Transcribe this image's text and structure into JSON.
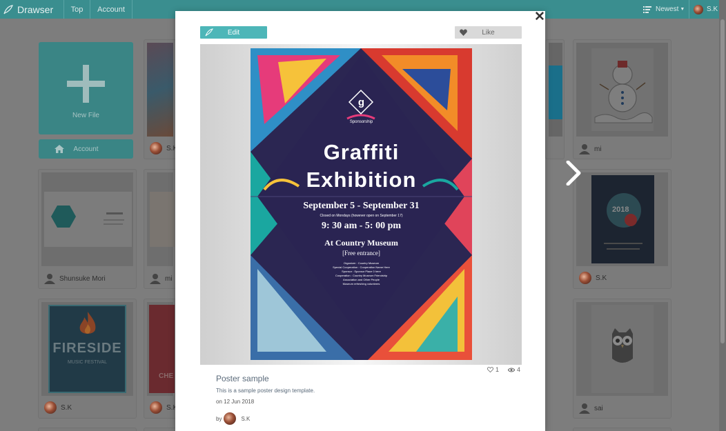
{
  "header": {
    "brand": "Drawser",
    "nav": [
      "Top",
      "Account"
    ],
    "sort_label": "Newest",
    "user_name": "S.K"
  },
  "sidebar_tiles": {
    "new_file_label": "New File",
    "account_label": "Account"
  },
  "grid": {
    "row1": [
      {
        "author": "S.K"
      },
      {
        "author": "mi"
      }
    ],
    "row2": [
      {
        "author": "Shunsuke Mori"
      },
      {
        "author": "mi"
      },
      {
        "author": "S.K"
      }
    ],
    "row3": [
      {
        "author": "S.K"
      },
      {
        "author": "S.K"
      },
      {
        "author": "sai"
      }
    ]
  },
  "thumbs": {
    "fireside_title": "FIRESIDE",
    "fireside_sub": "MUSIC FESTIVAL",
    "poster2018_year": "2018",
    "che_text": "CHE"
  },
  "modal": {
    "edit_label": "Edit",
    "like_label": "Like",
    "likes": "1",
    "views": "4",
    "title": "Poster sample",
    "description": "This is a sample poster design template.",
    "date": "on 12 Jun 2018",
    "by_label": "by",
    "author": "S.K"
  },
  "poster": {
    "logo_letter": "g",
    "sponsor": "Sponsorship",
    "title_line1": "Graffiti",
    "title_line2": "Exhibition",
    "dates": "September 5 - September 31",
    "closed_note": "Closed on Mondays (however open on September 17)",
    "hours": "9: 30 am - 5: 00 pm",
    "venue": "At Country Museum",
    "entrance": "[Free entrance]",
    "credits": [
      "Organizer : Country Museum",
      "Special Cooperation : Cooperation Name Here",
      "Sponsor : Sponsor Place 0 here",
      "Cooperation : Country Museum Friendship",
      "Association and Other People",
      "Museum refreshing volunteers"
    ]
  }
}
